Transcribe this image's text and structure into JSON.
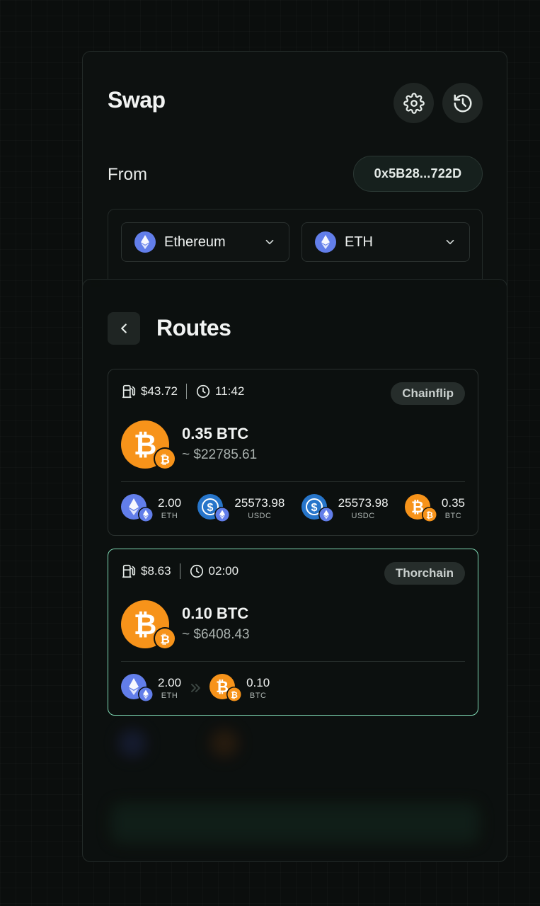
{
  "swap": {
    "title": "Swap",
    "from_label": "From",
    "address": "0x5B28...722D",
    "network": "Ethereum",
    "token": "ETH"
  },
  "routes": {
    "title": "Routes",
    "items": [
      {
        "gas": "$43.72",
        "time": "11:42",
        "provider": "Chainflip",
        "amount": "0.35 BTC",
        "usd": "~ $22785.61",
        "steps": [
          {
            "value": "2.00",
            "symbol": "ETH"
          },
          {
            "value": "25573.98",
            "symbol": "USDC"
          },
          {
            "value": "25573.98",
            "symbol": "USDC"
          },
          {
            "value": "0.35",
            "symbol": "BTC"
          }
        ]
      },
      {
        "gas": "$8.63",
        "time": "02:00",
        "provider": "Thorchain",
        "amount": "0.10 BTC",
        "usd": "~ $6408.43",
        "steps": [
          {
            "value": "2.00",
            "symbol": "ETH"
          },
          {
            "value": "0.10",
            "symbol": "BTC"
          }
        ]
      }
    ]
  },
  "colors": {
    "background": "#0b0e0d",
    "selected_border": "#7fd9b4",
    "btc": "#f7931a",
    "eth": "#627eea",
    "usdc": "#2775ca"
  }
}
